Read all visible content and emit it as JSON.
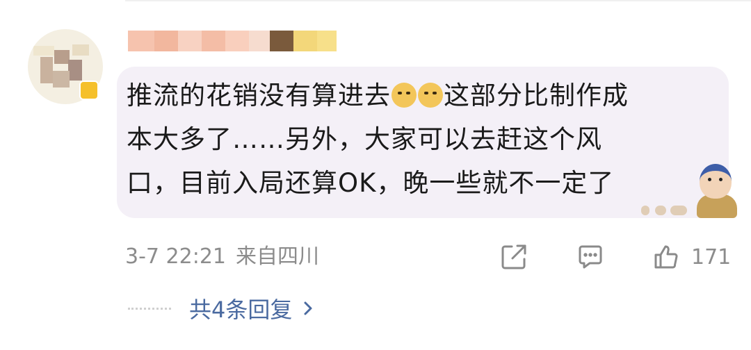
{
  "comment": {
    "text_line1_a": "推流的花销没有算进去",
    "text_line1_b": "这部分比制作成",
    "text_line2": "本大多了……另外，大家可以去赶这个风",
    "text_line3": "口，目前入局还算OK，晚一些就不一定了",
    "inline_emojis": [
      "doge-emoji",
      "doge-emoji"
    ],
    "sticker": "girl-with-pearl-earring-sticker"
  },
  "meta": {
    "date_time": "3-7 22:21",
    "location": "来自四川"
  },
  "actions": {
    "share_icon": "share-icon",
    "comment_icon": "comment-icon",
    "like_icon": "thumbs-up-icon",
    "like_count": "171"
  },
  "replies": {
    "label": "共4条回复",
    "chevron_icon": "chevron-right-icon"
  },
  "colors": {
    "bubble_bg": "#f4f0f7",
    "reply_link": "#4a6aa0",
    "meta_text": "#8c8c8c",
    "vip_badge": "#f5c02b"
  }
}
